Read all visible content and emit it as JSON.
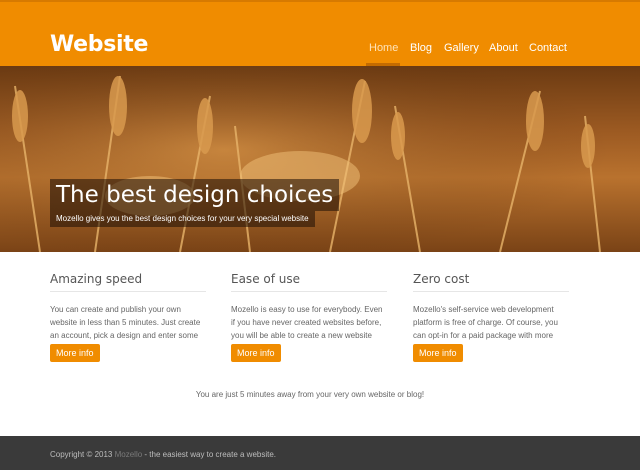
{
  "site": {
    "logo": "Website"
  },
  "nav": {
    "items": [
      {
        "label": "Home",
        "active": true
      },
      {
        "label": "Blog"
      },
      {
        "label": "Gallery"
      },
      {
        "label": "About"
      },
      {
        "label": "Contact"
      }
    ]
  },
  "hero": {
    "title": "The best design choices",
    "subtitle": "Mozello gives you the best design choices for your very special website"
  },
  "features": [
    {
      "title": "Amazing speed",
      "text": "You can create and publish your own website in less than 5 minutes. Just create an account, pick a design and enter some text.",
      "button": "More info"
    },
    {
      "title": "Ease of use",
      "text": "Mozello is easy to use for everybody. Even if you have never created websites before, you will be able to create a new website quickly.",
      "button": "More info"
    },
    {
      "title": "Zero cost",
      "text": "Mozello's self-service web development platform is free of charge. Of course, you can opt-in for a paid package with more features.",
      "button": "More info"
    }
  ],
  "tagline": "You are just 5 minutes away from your very own website or blog!",
  "footer": {
    "copyright": "Copyright © 2013",
    "brand": "Mozello",
    "rest": " - the easiest way to create a website."
  },
  "colors": {
    "accent": "#f08c00",
    "footer_bg": "#3a3a3a"
  }
}
